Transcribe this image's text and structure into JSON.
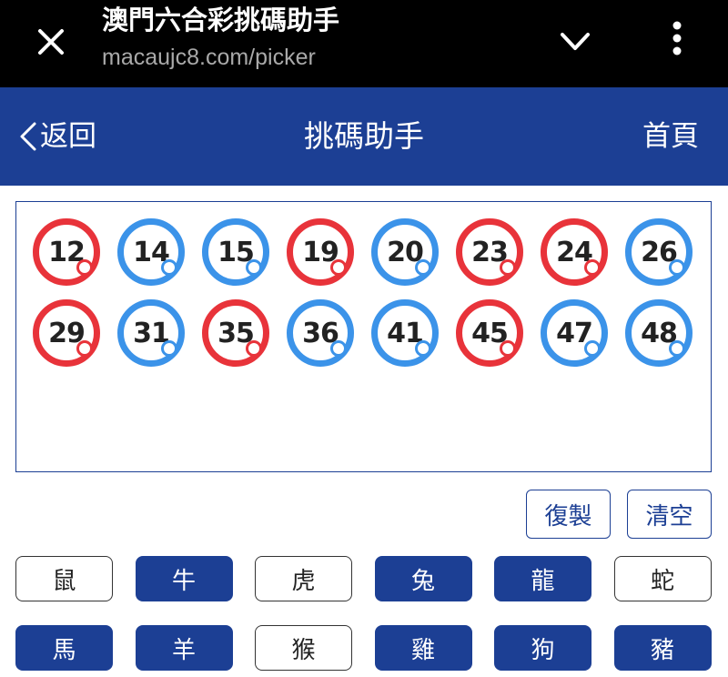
{
  "browser": {
    "page_title": "澳門六合彩挑碼助手",
    "url": "macaujc8.com/picker"
  },
  "nav": {
    "back_label": "返回",
    "title": "挑碼助手",
    "home_label": "首頁"
  },
  "picked_numbers": [
    {
      "value": "12",
      "color": "red"
    },
    {
      "value": "14",
      "color": "blue"
    },
    {
      "value": "15",
      "color": "blue"
    },
    {
      "value": "19",
      "color": "red"
    },
    {
      "value": "20",
      "color": "blue"
    },
    {
      "value": "23",
      "color": "red"
    },
    {
      "value": "24",
      "color": "red"
    },
    {
      "value": "26",
      "color": "blue"
    },
    {
      "value": "29",
      "color": "red"
    },
    {
      "value": "31",
      "color": "blue"
    },
    {
      "value": "35",
      "color": "red"
    },
    {
      "value": "36",
      "color": "blue"
    },
    {
      "value": "41",
      "color": "blue"
    },
    {
      "value": "45",
      "color": "red"
    },
    {
      "value": "47",
      "color": "blue"
    },
    {
      "value": "48",
      "color": "blue"
    }
  ],
  "actions": {
    "copy_label": "復製",
    "clear_label": "清空"
  },
  "zodiacs": [
    {
      "label": "鼠",
      "selected": false
    },
    {
      "label": "牛",
      "selected": true
    },
    {
      "label": "虎",
      "selected": false
    },
    {
      "label": "兔",
      "selected": true
    },
    {
      "label": "龍",
      "selected": true
    },
    {
      "label": "蛇",
      "selected": false
    },
    {
      "label": "馬",
      "selected": true
    },
    {
      "label": "羊",
      "selected": true
    },
    {
      "label": "猴",
      "selected": false
    },
    {
      "label": "雞",
      "selected": true
    },
    {
      "label": "狗",
      "selected": true
    },
    {
      "label": "豬",
      "selected": true
    }
  ],
  "colors": {
    "primary": "#1c3f94",
    "ball_red": "#e8333a",
    "ball_blue": "#3b93e9",
    "browser_bar": "#000000"
  }
}
